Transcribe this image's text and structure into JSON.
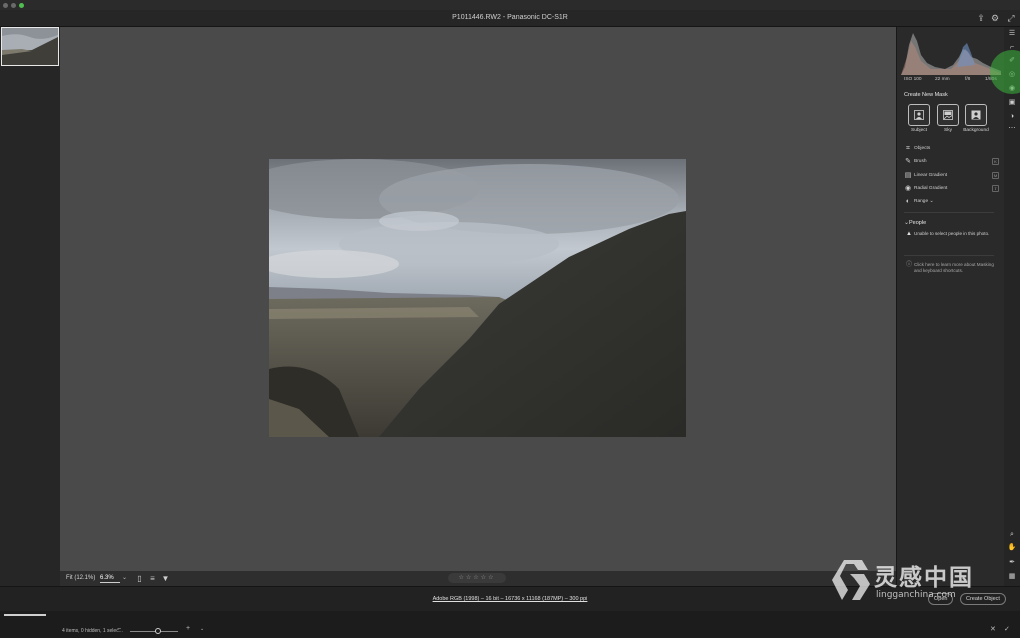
{
  "window": {
    "title": "P1011446.RW2  -  Panasonic DC-S1R"
  },
  "canvas_toolbar": {
    "fit_label": "Fit (12.1%)",
    "zoom_value": "6.3%",
    "zoom_caret": "⌄",
    "rating_stars": "☆☆☆☆☆"
  },
  "statusbar": {
    "info_text": "Adobe RGB (1998) – 16 bit – 16736 x 11168 (187MP) – 300 ppi",
    "open_button": "Open",
    "save_button": "Create Object"
  },
  "library": {
    "items_text": "4 items, 0 hidden, 1 selec..."
  },
  "histogram": {
    "iso": "ISO 100",
    "focal": "22 mm",
    "aperture": "f/8",
    "shutter": "1/80s"
  },
  "masking": {
    "section_title": "Create New Mask",
    "buttons": [
      {
        "label": "Subject",
        "icon": "subject-icon"
      },
      {
        "label": "Sky",
        "icon": "sky-icon"
      },
      {
        "label": "Background",
        "icon": "background-icon"
      }
    ],
    "tools": [
      {
        "label": "Objects",
        "icon": "objects-icon"
      },
      {
        "label": "Brush",
        "icon": "brush-icon"
      },
      {
        "label": "Linear Gradient",
        "icon": "linear-gradient-icon"
      },
      {
        "label": "Radial Gradient",
        "icon": "radial-gradient-icon"
      },
      {
        "label": "Range ⌄",
        "icon": "range-icon"
      }
    ],
    "people_title": "People",
    "people_warning": "Unable to select people in this photo.",
    "help_text": "Click here to learn more about Masking and keyboard shortcuts."
  },
  "watermark": {
    "main": "灵感中国",
    "sub": "lingganchina.com"
  },
  "colors": {
    "canvas_bg": "#4a4a4a",
    "panel_bg": "#2a2a2a",
    "highlight": "#3cb43c"
  }
}
